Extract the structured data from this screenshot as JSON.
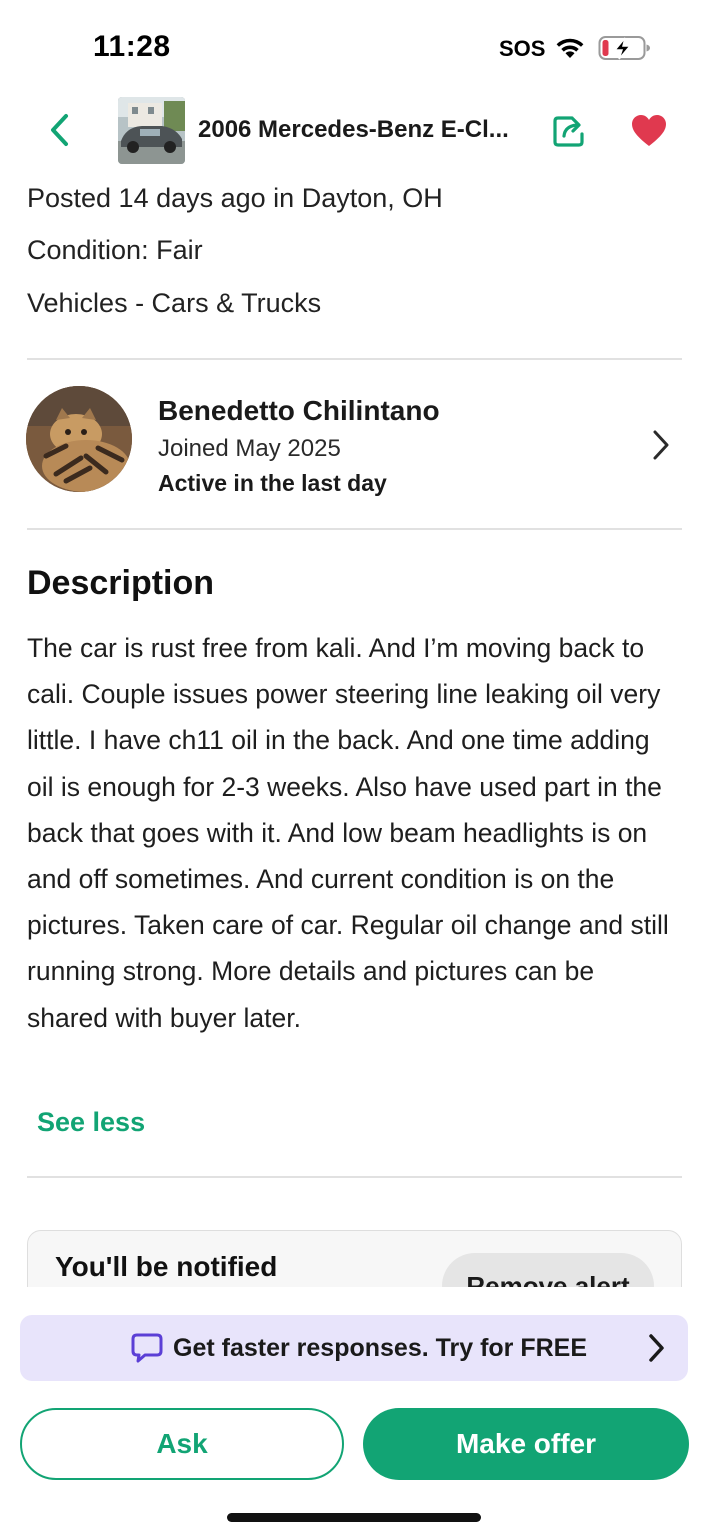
{
  "status_bar": {
    "time": "11:28",
    "sos": "SOS"
  },
  "nav": {
    "title": "2006 Mercedes-Benz E-Cl...",
    "icons": [
      "back-icon",
      "share-icon",
      "heart-icon"
    ]
  },
  "listing": {
    "posted": "Posted 14 days ago in Dayton, OH",
    "condition": "Condition: Fair",
    "category": "Vehicles - Cars & Trucks"
  },
  "seller": {
    "name": "Benedetto Chilintano",
    "joined": "Joined May 2025",
    "activity": "Active in the last day"
  },
  "description": {
    "heading": "Description",
    "body": "The car is rust free from kali. And I’m moving back to cali. Couple issues power steering line leaking oil very little. I have ch11 oil in the back. And one time adding oil is enough for 2-3 weeks. Also have used part in the back that goes with it. And low beam headlights is on and off sometimes. And current condition is on the pictures. Taken care of car. Regular oil change and still running strong. More details and pictures can be shared with buyer later.",
    "toggle_label": "See less"
  },
  "alert_card": {
    "title": "You'll be notified",
    "remove_label": "Remove alert"
  },
  "promo": {
    "text": "Get faster responses. Try for FREE"
  },
  "actions": {
    "ask_label": "Ask",
    "offer_label": "Make offer"
  },
  "colors": {
    "accent_green": "#12a474",
    "heart_red": "#e0394f",
    "promo_bg": "#e8e4fb",
    "promo_icon": "#5b3fd6"
  }
}
